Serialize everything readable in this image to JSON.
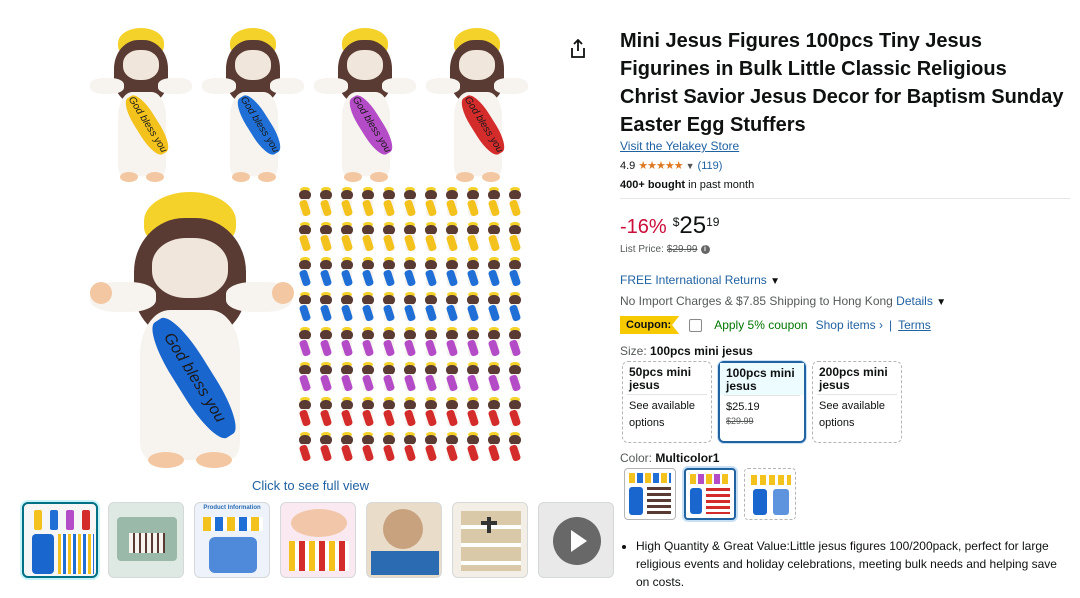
{
  "product": {
    "title": "Mini Jesus Figures 100pcs Tiny Jesus Figurines in Bulk Little Classic Religious Christ Savior Jesus Decor for Baptism Sunday Easter Egg Stuffers",
    "store_link": "Visit the Yelakey Store",
    "rating_value": "4.9",
    "stars": "★★★★★",
    "rating_count": "(119)",
    "bought_bold": "400+ bought",
    "bought_rest": " in past month"
  },
  "gallery": {
    "sash_text": "God bless you",
    "full_view_link": "Click to see full view",
    "thumbnails": [
      {
        "label": ""
      },
      {
        "label": ""
      },
      {
        "label": "Product Information"
      },
      {
        "label": ""
      },
      {
        "label": ""
      },
      {
        "label": ""
      },
      {
        "label": ""
      }
    ],
    "figure_colors": [
      "#f3c21c",
      "#1f6fd6",
      "#b44bc7",
      "#d42b2b"
    ],
    "main_sash_color": "#1a66cf"
  },
  "pricing": {
    "discount": "-16%",
    "currency": "$",
    "whole": "25",
    "fraction": "19",
    "list_price_label": "List Price:",
    "list_price": "$29.99",
    "info_icon": "i"
  },
  "delivery": {
    "returns": "FREE International Returns",
    "import_text": "No Import Charges & $7.85 Shipping to Hong Kong ",
    "details_link": "Details"
  },
  "coupon": {
    "badge": "Coupon:",
    "apply": "Apply 5% coupon",
    "shop_items": "Shop items ›",
    "separator": "|",
    "terms": "Terms"
  },
  "size": {
    "label": "Size:",
    "selected": "100pcs mini jesus",
    "options": [
      {
        "name": "50pcs mini jesus",
        "line1": "See available",
        "line2": "options",
        "old": ""
      },
      {
        "name": "100pcs mini jesus",
        "line1": "$25.19",
        "line2": "",
        "old": "$29.99"
      },
      {
        "name": "200pcs mini jesus",
        "line1": "See available",
        "line2": "options",
        "old": ""
      }
    ]
  },
  "color": {
    "label": "Color:",
    "selected": "Multicolor1"
  },
  "bullets": [
    "High Quantity & Great Value:Little jesus figures 100/200pack, perfect for large religious events and holiday celebrations, meeting bulk needs and helping save on costs."
  ]
}
